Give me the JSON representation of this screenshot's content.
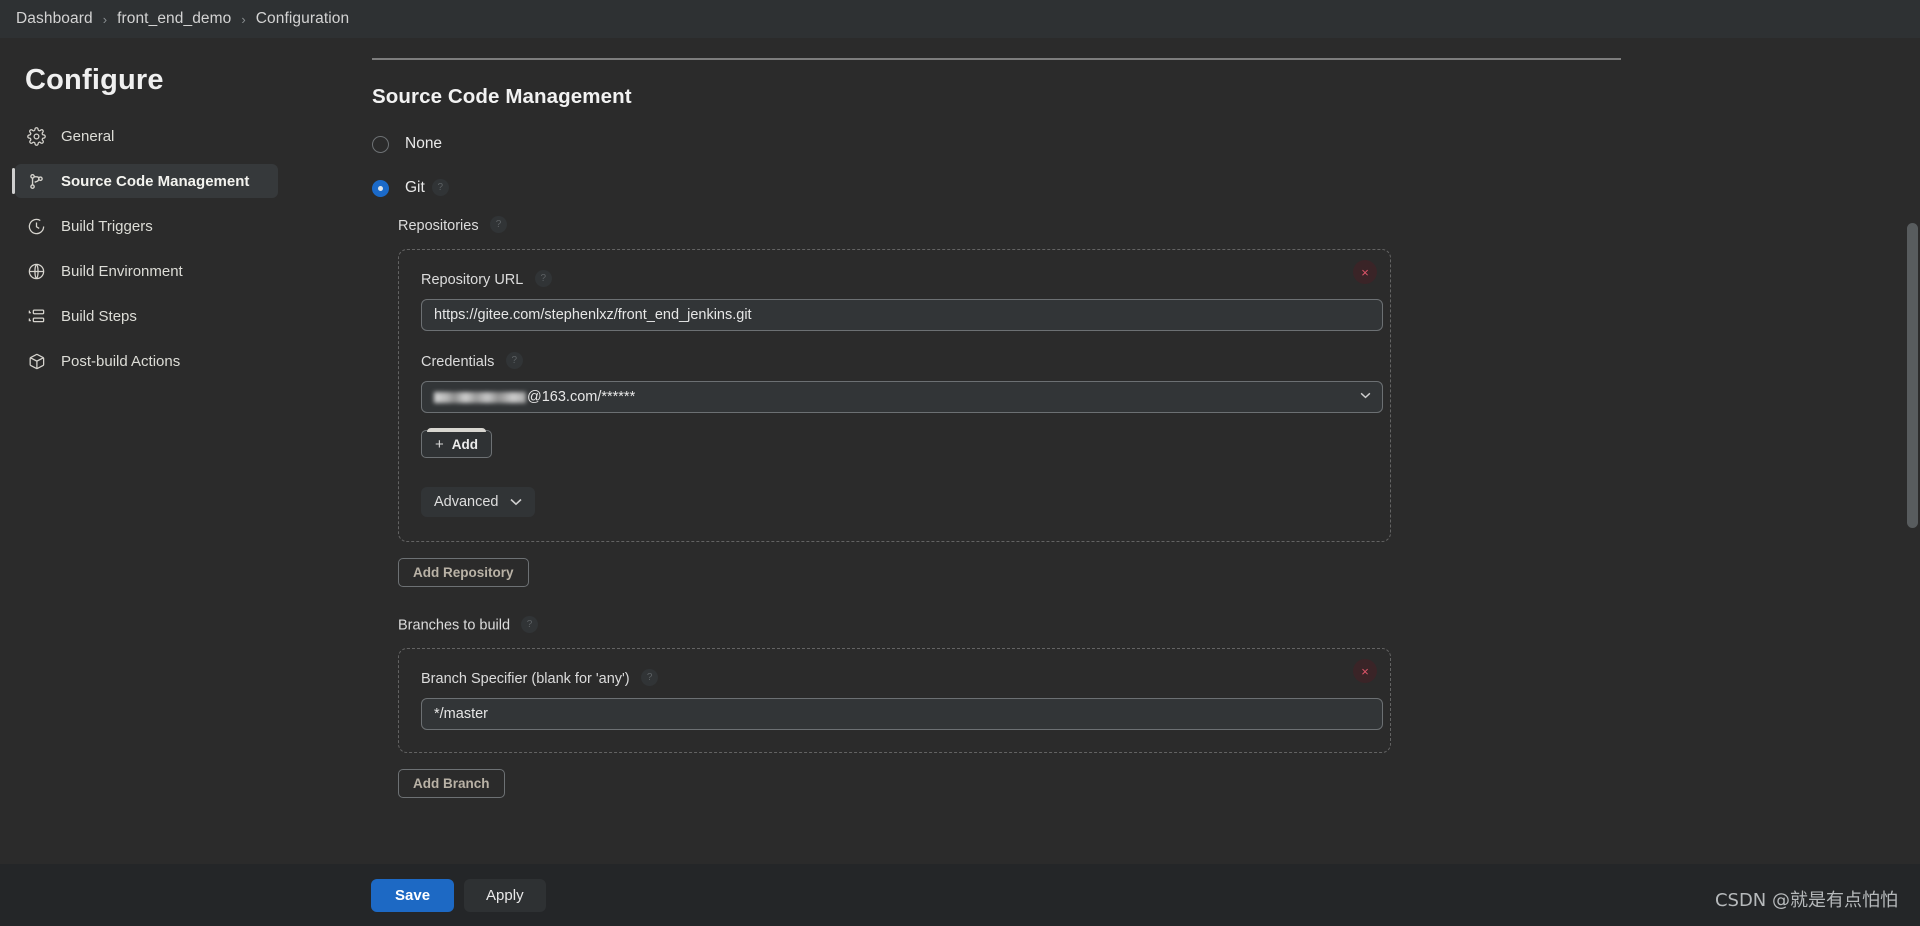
{
  "breadcrumb": {
    "items": [
      "Dashboard",
      "front_end_demo",
      "Configuration"
    ],
    "separator": "›"
  },
  "sidebar": {
    "title": "Configure",
    "items": [
      {
        "label": "General",
        "icon": "gear-icon",
        "active": false
      },
      {
        "label": "Source Code Management",
        "icon": "branch-icon",
        "active": true
      },
      {
        "label": "Build Triggers",
        "icon": "clock-icon",
        "active": false
      },
      {
        "label": "Build Environment",
        "icon": "globe-icon",
        "active": false
      },
      {
        "label": "Build Steps",
        "icon": "list-icon",
        "active": false
      },
      {
        "label": "Post-build Actions",
        "icon": "package-icon",
        "active": false
      }
    ]
  },
  "main": {
    "section_title": "Source Code Management",
    "scm_options": [
      {
        "label": "None",
        "selected": false
      },
      {
        "label": "Git",
        "selected": true,
        "help": "?"
      }
    ],
    "repositories": {
      "caption": "Repositories",
      "help": "?",
      "repository_url": {
        "label": "Repository URL",
        "help": "?",
        "value": "https://gitee.com/stephenlxz/front_end_jenkins.git"
      },
      "credentials": {
        "label": "Credentials",
        "help": "?",
        "value_redacted": true,
        "value_suffix": "@163.com/******"
      },
      "add_credentials_label": "Add",
      "add_plus": "+",
      "advanced_label": "Advanced",
      "delete_tooltip": "×"
    },
    "add_repository_label": "Add Repository",
    "branches": {
      "caption": "Branches to build",
      "help": "?",
      "branch_specifier": {
        "label": "Branch Specifier (blank for 'any')",
        "help": "?",
        "value": "*/master"
      },
      "delete_tooltip": "×"
    },
    "add_branch_label": "Add Branch"
  },
  "footer": {
    "save_label": "Save",
    "apply_label": "Apply"
  },
  "watermark": "CSDN @就是有点怕怕",
  "colors": {
    "accent_blue": "#1d69c4",
    "page_bg": "#2b2b2b",
    "danger_red": "#e0556a"
  }
}
